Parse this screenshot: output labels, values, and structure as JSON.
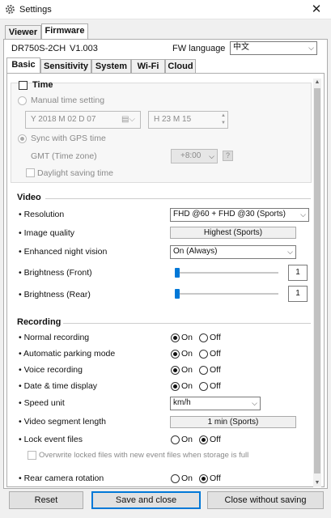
{
  "window": {
    "title": "Settings",
    "close_glyph": "✕"
  },
  "main_tabs": [
    "Viewer",
    "Firmware"
  ],
  "device": {
    "model": "DR750S-2CH",
    "version": "V1.003"
  },
  "fw_language": {
    "label": "FW language",
    "value": "中文"
  },
  "sub_tabs": [
    "Basic",
    "Sensitivity",
    "System",
    "Wi-Fi",
    "Cloud"
  ],
  "time": {
    "title": "Time",
    "manual_label": "Manual time setting",
    "date_value": "Y 2018 M 02 D 07",
    "time_value": "H 23 M 15",
    "gps_label": "Sync with GPS time",
    "gmt_label": "GMT (Time zone)",
    "gmt_value": "+8:00",
    "help_glyph": "?",
    "dst_label": "Daylight saving time"
  },
  "video": {
    "title": "Video",
    "resolution_label": "Resolution",
    "resolution_value": "FHD @60 + FHD @30 (Sports)",
    "quality_label": "Image quality",
    "quality_value": "Highest (Sports)",
    "night_label": "Enhanced night vision",
    "night_value": "On (Always)",
    "bright_front_label": "Brightness (Front)",
    "bright_front_value": "1",
    "bright_rear_label": "Brightness (Rear)",
    "bright_rear_value": "1"
  },
  "recording": {
    "title": "Recording",
    "on_label": "On",
    "off_label": "Off",
    "normal_label": "Normal recording",
    "parking_label": "Automatic parking mode",
    "voice_label": "Voice recording",
    "datetime_label": "Date & time display",
    "speed_label": "Speed unit",
    "speed_value": "km/h",
    "segment_label": "Video segment length",
    "segment_value": "1 min (Sports)",
    "lock_label": "Lock event files",
    "overwrite_label": "Overwrite locked files with new event files when storage is full",
    "rear_label": "Rear camera rotation"
  },
  "buttons": {
    "reset": "Reset",
    "save": "Save and close",
    "close_no_save": "Close without saving"
  },
  "colors": {
    "accent": "#0078d7"
  }
}
